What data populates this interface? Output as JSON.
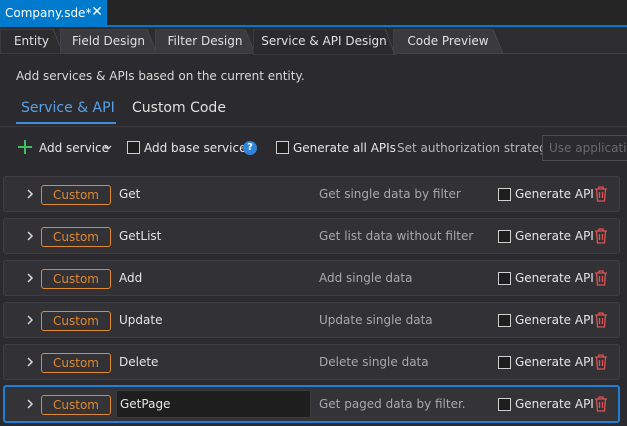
{
  "document_tab": {
    "title": "Company.sde*",
    "close_symbol": "✕"
  },
  "tabs": [
    {
      "label": "Entity"
    },
    {
      "label": "Field Design"
    },
    {
      "label": "Filter Design"
    },
    {
      "label": "Service & API Design",
      "active": true
    },
    {
      "label": "Code Preview"
    }
  ],
  "hint": "Add services & APIs based on the current entity.",
  "subtabs": [
    {
      "label": "Service & API",
      "active": true
    },
    {
      "label": "Custom Code",
      "active": false
    }
  ],
  "toolbar": {
    "add_service": "Add service",
    "add_base_services": "Add base services",
    "add_base_services_checked": false,
    "help_symbol": "?",
    "generate_all_apis": "Generate all APIs",
    "generate_all_apis_checked": false,
    "authorization_label": "Set authorization strategy:",
    "authorization_placeholder": "Use application"
  },
  "services": [
    {
      "type": "Custom",
      "name": "Get",
      "description": "Get single data by filter",
      "generate_label": "Generate API",
      "generate_checked": false
    },
    {
      "type": "Custom",
      "name": "GetList",
      "description": "Get list data without filter",
      "generate_label": "Generate API",
      "generate_checked": false
    },
    {
      "type": "Custom",
      "name": "Add",
      "description": "Add single data",
      "generate_label": "Generate API",
      "generate_checked": false
    },
    {
      "type": "Custom",
      "name": "Update",
      "description": "Update single data",
      "generate_label": "Generate API",
      "generate_checked": false
    },
    {
      "type": "Custom",
      "name": "Delete",
      "description": "Delete single data",
      "generate_label": "Generate API",
      "generate_checked": false
    },
    {
      "type": "Custom",
      "name": "GetPage",
      "description": "Get paged data by filter.",
      "generate_label": "Generate API",
      "generate_checked": false,
      "editing": true
    }
  ],
  "colors": {
    "accent": "#007acc",
    "badge": "#e0892f",
    "delete": "#e05252",
    "add": "#3fbf5f",
    "help": "#2f83d8"
  },
  "icons": {
    "close": "close-icon",
    "add": "plus-icon",
    "dropdown": "chevron-down-icon",
    "help": "help-icon",
    "expand": "chevron-right-icon",
    "delete": "trash-icon"
  }
}
